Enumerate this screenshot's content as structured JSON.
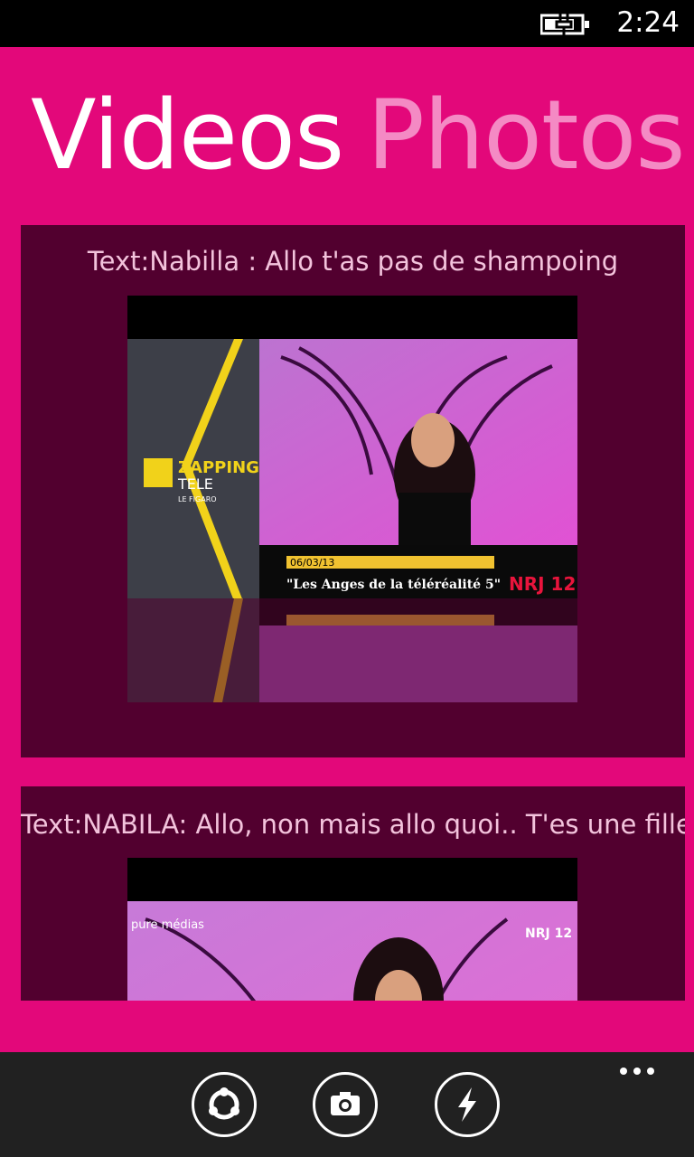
{
  "status_bar": {
    "time": "2:24",
    "icon": "battery-charging-icon"
  },
  "pivot": {
    "tabs": [
      {
        "label": "Videos"
      },
      {
        "label": "Photos"
      }
    ]
  },
  "videos": [
    {
      "title": "Text:Nabilla : Allo t'as pas de shampoing",
      "overlay": {
        "logo_top": "ZAPPING",
        "logo_bottom": "TELE",
        "source": "LE FIGARO",
        "date": "06/03/13",
        "caption": "\"Les Anges de la téléréalité 5\"",
        "channel": "NRJ 12"
      }
    },
    {
      "title": "Text:NABILA: Allo, non mais allo quoi.. T'es une fille ta",
      "overlay": {
        "source": "pure médias",
        "channel": "NRJ 12"
      }
    }
  ],
  "appbar": {
    "buttons": [
      {
        "icon": "refresh-icon"
      },
      {
        "icon": "camera-icon"
      },
      {
        "icon": "flash-icon"
      }
    ],
    "more_icon": "more-dots-icon"
  },
  "colors": {
    "accent": "#e3087a",
    "card": "#52002f",
    "appbar": "#212121",
    "inactive_tab": "#f48ac4"
  }
}
